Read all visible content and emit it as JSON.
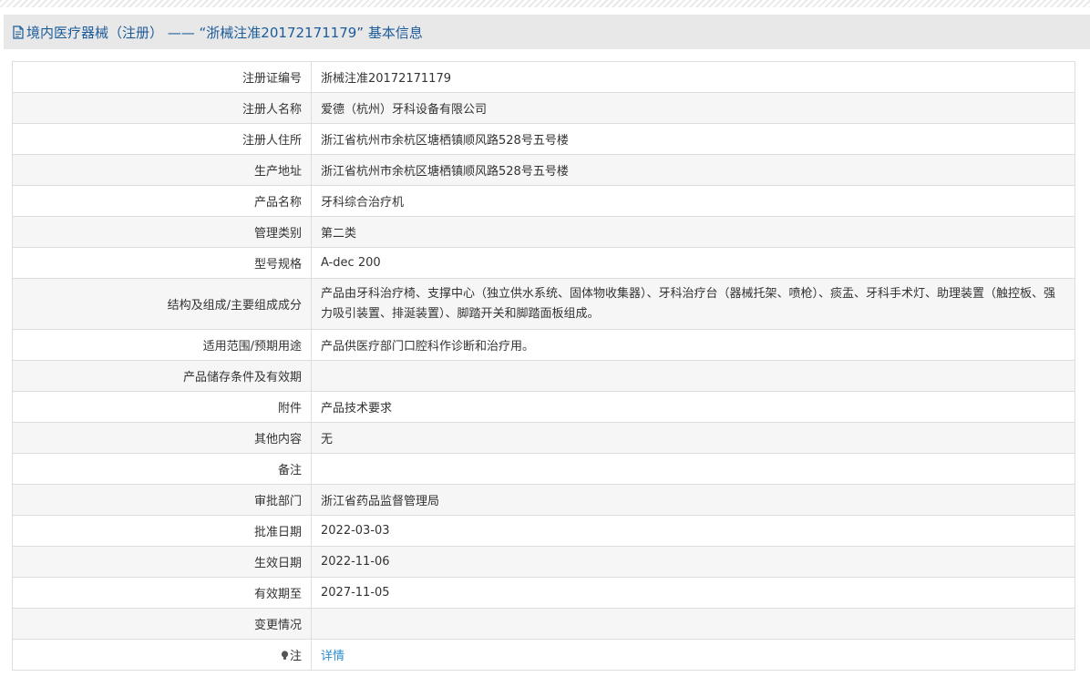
{
  "header": {
    "title": "境内医疗器械（注册） —— “浙械注准20172171179” 基本信息",
    "icon": "document-icon"
  },
  "rows": [
    {
      "label": "注册证编号",
      "value": "浙械注准20172171179"
    },
    {
      "label": "注册人名称",
      "value": "爱德（杭州）牙科设备有限公司"
    },
    {
      "label": "注册人住所",
      "value": "浙江省杭州市余杭区塘栖镇顺风路528号五号楼"
    },
    {
      "label": "生产地址",
      "value": "浙江省杭州市余杭区塘栖镇顺风路528号五号楼"
    },
    {
      "label": "产品名称",
      "value": "牙科综合治疗机"
    },
    {
      "label": "管理类别",
      "value": "第二类"
    },
    {
      "label": "型号规格",
      "value": "A-dec 200"
    },
    {
      "label": "结构及组成/主要组成成分",
      "value": "产品由牙科治疗椅、支撑中心（独立供水系统、固体物收集器）、牙科治疗台（器械托架、喷枪）、痰盂、牙科手术灯、助理装置（触控板、强力吸引装置、排涎装置）、脚踏开关和脚踏面板组成。"
    },
    {
      "label": "适用范围/预期用途",
      "value": "产品供医疗部门口腔科作诊断和治疗用。"
    },
    {
      "label": "产品储存条件及有效期",
      "value": ""
    },
    {
      "label": "附件",
      "value": "产品技术要求"
    },
    {
      "label": "其他内容",
      "value": "无"
    },
    {
      "label": "备注",
      "value": ""
    },
    {
      "label": "审批部门",
      "value": "浙江省药品监督管理局"
    },
    {
      "label": "批准日期",
      "value": "2022-03-03"
    },
    {
      "label": "生效日期",
      "value": "2022-11-06"
    },
    {
      "label": "有效期至",
      "value": "2027-11-05"
    },
    {
      "label": "变更情况",
      "value": ""
    }
  ],
  "note": {
    "label": "注",
    "icon": "lightbulb-icon",
    "link_text": "详情"
  },
  "colors": {
    "title": "#1c5b9a",
    "link": "#2b8ccf",
    "header_bg": "#e8e8e8",
    "row_alt_bg": "#f6f6f6",
    "border": "#dddddd"
  }
}
